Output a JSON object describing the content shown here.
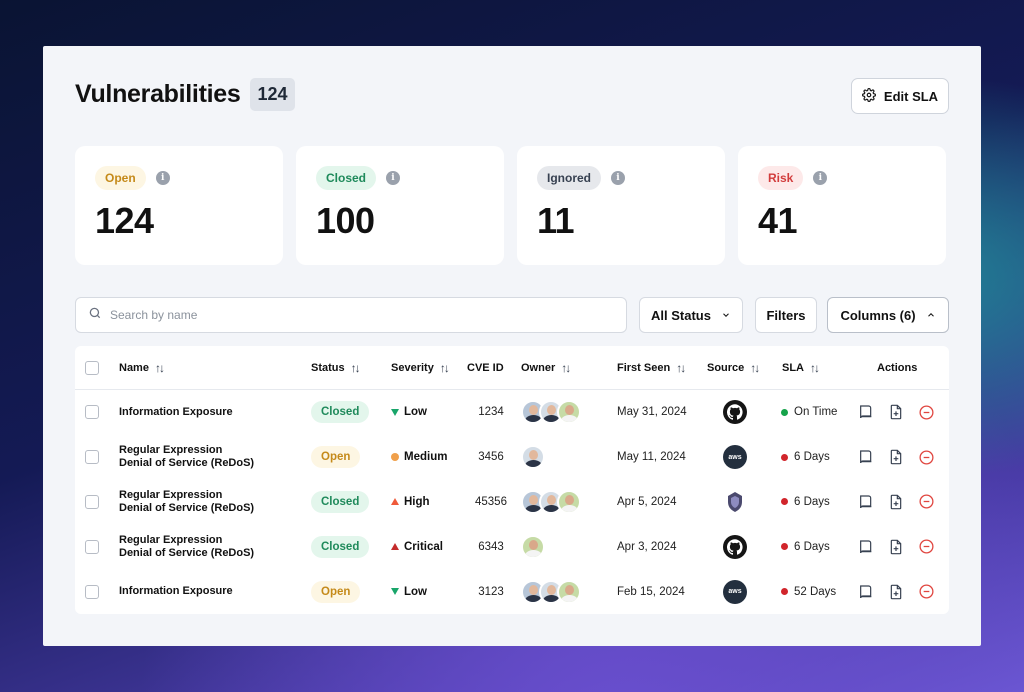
{
  "header": {
    "title": "Vulnerabilities",
    "count": "124",
    "edit_sla_label": "Edit SLA"
  },
  "cards": [
    {
      "label": "Open",
      "value": "124"
    },
    {
      "label": "Closed",
      "value": "100"
    },
    {
      "label": "Ignored",
      "value": "11"
    },
    {
      "label": "Risk",
      "value": "41"
    }
  ],
  "toolbar": {
    "search_placeholder": "Search by name",
    "status_label": "All Status",
    "filters_label": "Filters",
    "columns_label": "Columns (6)"
  },
  "table": {
    "columns": [
      "Name",
      "Status",
      "Severity",
      "CVE ID",
      "Owner",
      "First Seen",
      "Source",
      "SLA",
      "Actions"
    ],
    "rows": [
      {
        "name1": "Information Exposure",
        "name2": "",
        "status": "Closed",
        "severity": "Low",
        "cve": "1234",
        "owners": 3,
        "first_seen": "May 31, 2024",
        "source": "github",
        "sla": "On Time",
        "sla_state": "ok"
      },
      {
        "name1": "Regular Expression",
        "name2": "Denial of Service (ReDoS)",
        "status": "Open",
        "severity": "Medium",
        "cve": "3456",
        "owners": 1,
        "first_seen": "May 11, 2024",
        "source": "aws",
        "sla": "6 Days",
        "sla_state": "late"
      },
      {
        "name1": "Regular Expression",
        "name2": "Denial of Service (ReDoS)",
        "status": "Closed",
        "severity": "High",
        "cve": "45356",
        "owners": 3,
        "first_seen": "Apr 5, 2024",
        "source": "shield",
        "sla": "6 Days",
        "sla_state": "late"
      },
      {
        "name1": "Regular Expression",
        "name2": "Denial of Service (ReDoS)",
        "status": "Closed",
        "severity": "Critical",
        "cve": "6343",
        "owners": 1,
        "first_seen": "Apr 3, 2024",
        "source": "github",
        "sla": "6 Days",
        "sla_state": "late"
      },
      {
        "name1": "Information Exposure",
        "name2": "",
        "status": "Open",
        "severity": "Low",
        "cve": "3123",
        "owners": 3,
        "first_seen": "Feb 15, 2024",
        "source": "aws",
        "sla": "52 Days",
        "sla_state": "late"
      }
    ]
  },
  "icons": {
    "aws_text": "aws"
  },
  "colors": {
    "closed": "#1f8a5b",
    "open": "#c58a1a",
    "risk": "#d23c3c",
    "low": "#19a56a",
    "high": "#ef5a3a",
    "critical": "#c42b2b",
    "medium": "#f0a04b"
  }
}
